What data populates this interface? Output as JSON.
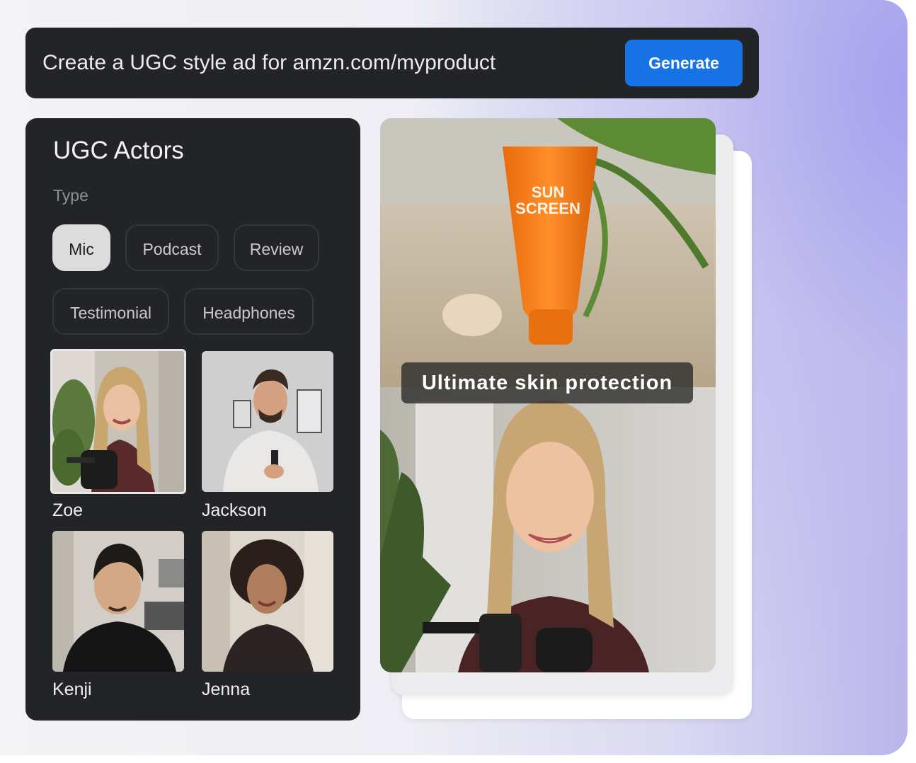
{
  "prompt_bar": {
    "text": "Create a UGC style ad for amzn.com/myproduct",
    "generate_label": "Generate"
  },
  "actors_panel": {
    "title": "UGC Actors",
    "type_label": "Type",
    "types": [
      "Mic",
      "Podcast",
      "Review",
      "Testimonial",
      "Headphones"
    ],
    "selected_type": "Mic",
    "actors": [
      {
        "name": "Zoe",
        "selected": true
      },
      {
        "name": "Jackson",
        "selected": false
      },
      {
        "name": "Kenji",
        "selected": false
      },
      {
        "name": "Jenna",
        "selected": false
      }
    ]
  },
  "preview": {
    "product_label_line1": "SUN",
    "product_label_line2": "SCREEN",
    "caption": "Ultimate skin protection"
  },
  "colors": {
    "accent": "#1772e6",
    "panel": "#232428",
    "product": "#f07a16"
  }
}
